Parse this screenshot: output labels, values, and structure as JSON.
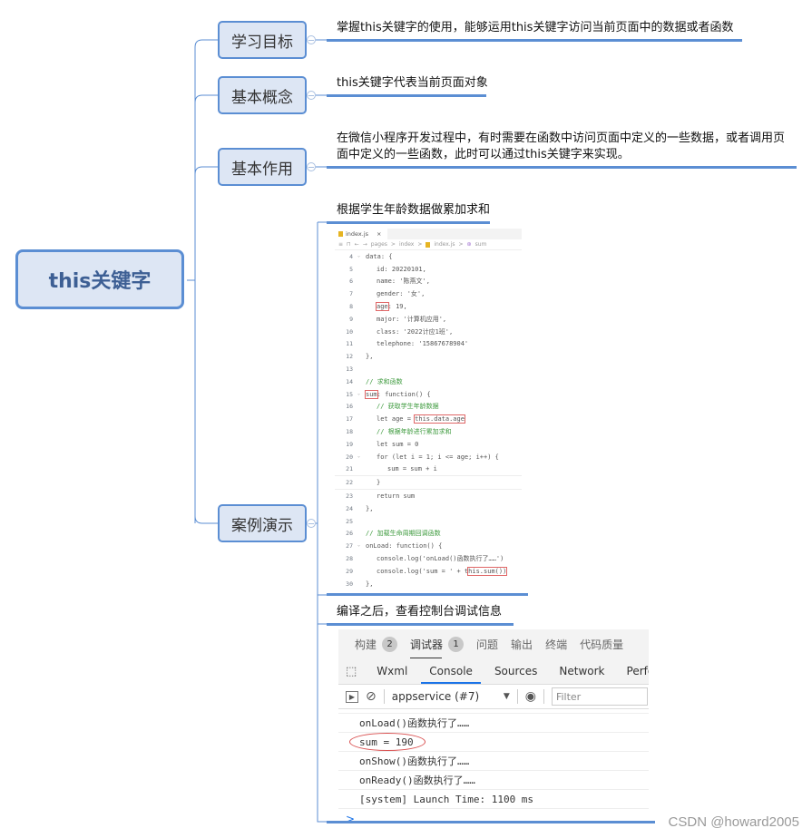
{
  "root": {
    "label": "this关键字"
  },
  "branches": [
    {
      "label": "学习目标",
      "leaf": "掌握this关键字的使用，能够运用this关键字访问当前页面中的数据或者函数"
    },
    {
      "label": "基本概念",
      "leaf": "this关键字代表当前页面对象"
    },
    {
      "label": "基本作用",
      "leaf_line1": "在微信小程序开发过程中，有时需要在函数中访问页面中定义的一些数据，或者调用页",
      "leaf_line2": "面中定义的一些函数，此时可以通过this关键字来实现。"
    },
    {
      "label": "案例演示",
      "leaf1": "根据学生年龄数据做累加求和",
      "leaf2": "编译之后，查看控制台调试信息"
    }
  ],
  "editor": {
    "tab": "index.js",
    "tab_close": "×",
    "breadcrumb": [
      "pages",
      ">",
      "index",
      ">",
      "index.js",
      ">",
      "sum"
    ],
    "lines": [
      {
        "n": "4",
        "text": "data: {"
      },
      {
        "n": "5",
        "text": "id: 20220101,"
      },
      {
        "n": "6",
        "text": "name: '陈燕文',"
      },
      {
        "n": "7",
        "text": "gender: '女',"
      },
      {
        "n": "8",
        "text": "age: 19,"
      },
      {
        "n": "9",
        "text": "major: '计算机应用',"
      },
      {
        "n": "10",
        "text": "class: '2022计应1班',"
      },
      {
        "n": "11",
        "text": "telephone: '15867678904'"
      },
      {
        "n": "12",
        "text": "},"
      },
      {
        "n": "13",
        "text": ""
      },
      {
        "n": "14",
        "text": "// 求和函数"
      },
      {
        "n": "15",
        "text": "sum: function() {"
      },
      {
        "n": "16",
        "text": "// 获取学生年龄数据"
      },
      {
        "n": "17",
        "text": "let age = this.data.age"
      },
      {
        "n": "18",
        "text": "// 根据年龄进行累加求和"
      },
      {
        "n": "19",
        "text": "let sum = 0"
      },
      {
        "n": "20",
        "text": "for (let i = 1; i <= age; i++) {"
      },
      {
        "n": "21",
        "text": "sum = sum + i"
      },
      {
        "n": "22",
        "text": "}"
      },
      {
        "n": "23",
        "text": "return sum"
      },
      {
        "n": "24",
        "text": "},"
      },
      {
        "n": "25",
        "text": ""
      },
      {
        "n": "26",
        "text": "// 加载生命周期回调函数"
      },
      {
        "n": "27",
        "text": "onLoad: function() {"
      },
      {
        "n": "28",
        "text": "console.log('onLoad()函数执行了……')"
      },
      {
        "n": "29",
        "text": "console.log('sum = ' + this.sum())"
      },
      {
        "n": "30",
        "text": "},"
      }
    ]
  },
  "devtools": {
    "top_tabs": [
      {
        "label": "构建",
        "badge": "2"
      },
      {
        "label": "调试器",
        "badge": "1"
      },
      {
        "label": "问题"
      },
      {
        "label": "输出"
      },
      {
        "label": "终端"
      },
      {
        "label": "代码质量"
      }
    ],
    "tabs": [
      "Wxml",
      "Console",
      "Sources",
      "Network",
      "Perforr"
    ],
    "context": "appservice (#7)",
    "filter_placeholder": "Filter",
    "console_lines": [
      "onLoad()函数执行了……",
      "sum = 190",
      "onShow()函数执行了……",
      "onReady()函数执行了……",
      "[system] Launch Time: 1100 ms"
    ],
    "prompt": ">"
  },
  "watermark": "CSDN @howard2005",
  "colors": {
    "accent": "#5b8ed3",
    "node_fill": "#dde6f4",
    "highlight": "#e06666",
    "tab_active": "#1a73e8"
  }
}
